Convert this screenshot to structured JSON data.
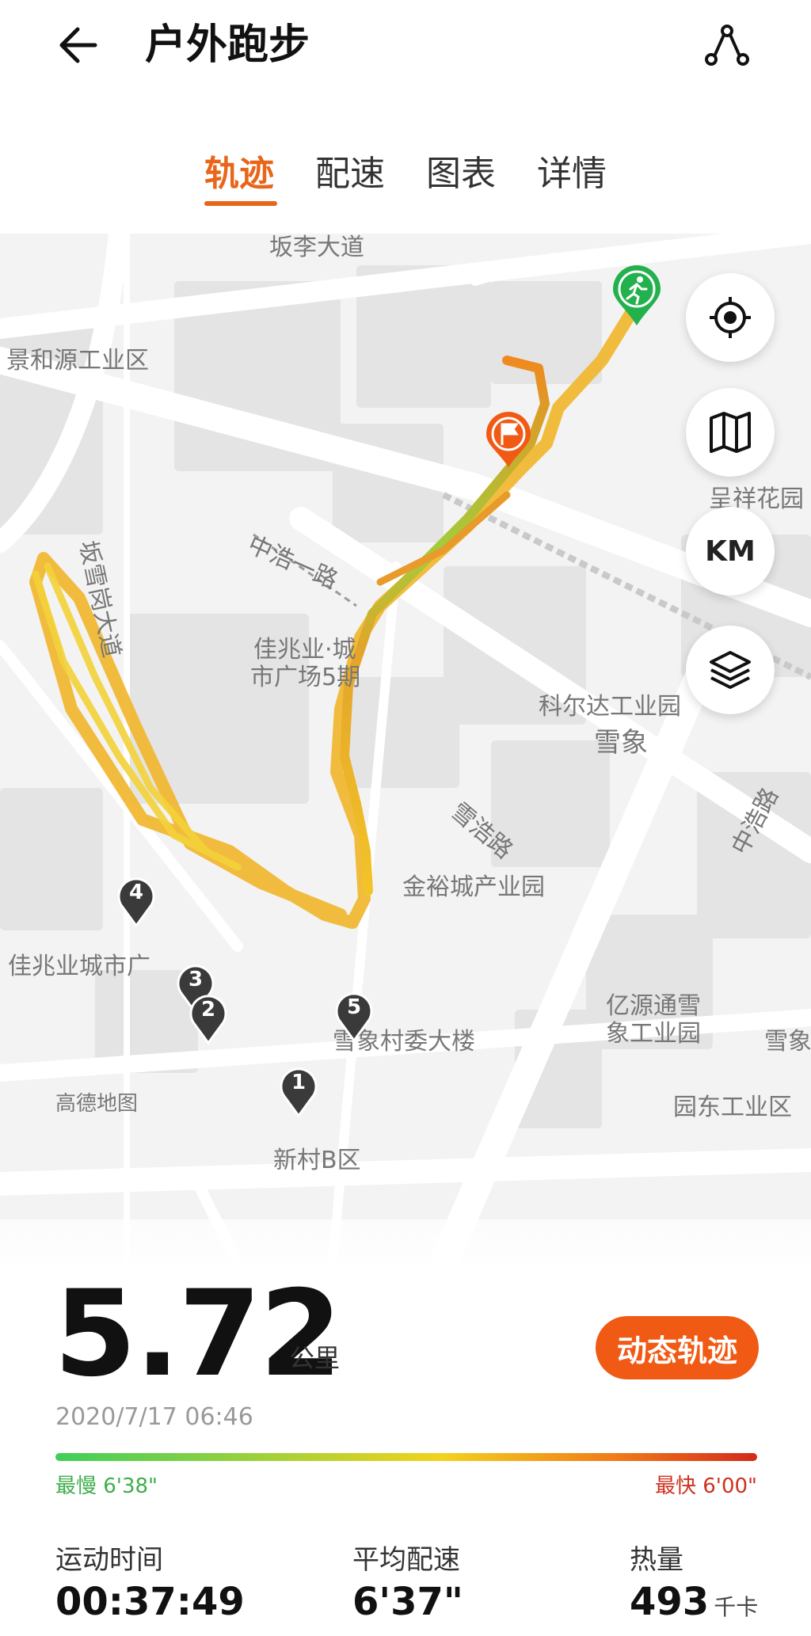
{
  "header": {
    "title": "户外跑步",
    "back_icon": "back-arrow-icon",
    "share_icon": "share-route-icon"
  },
  "tabs": [
    {
      "label": "轨迹",
      "active": true
    },
    {
      "label": "配速",
      "active": false
    },
    {
      "label": "图表",
      "active": false
    },
    {
      "label": "详情",
      "active": false
    }
  ],
  "map": {
    "labels": {
      "road_top": "坂李大道",
      "jinghe": "景和源工业区",
      "chengxiang": "呈祥花园",
      "zhonghao1": "中浩一路",
      "banxuegang": "坂雪岗大道",
      "jiazhao_a": "佳兆业·城",
      "jiazhao_b": "市广场5期",
      "keerda": "科尔达工业园",
      "xuexiang": "雪象",
      "xuehao": "雪浩路",
      "zhonghao": "中浩路",
      "jinyu": "金裕城产业园",
      "jiazhao_city": "佳兆业城市广",
      "yiyuan_a": "亿源通雪",
      "yiyuan_b": "象工业园",
      "xuexiang_right": "雪象",
      "xuexiang_cun": "雪象村委大楼",
      "gaode": "高德地图",
      "yuandong": "园东工业区",
      "xincun": "新村B区"
    },
    "km_markers": [
      "1",
      "2",
      "3",
      "4",
      "5"
    ],
    "controls": {
      "locate_icon": "locate-icon",
      "map_icon": "map-icon",
      "km_label": "KM",
      "layers_icon": "layers-icon"
    },
    "start_icon": "runner-start-icon",
    "end_icon": "finish-flag-icon"
  },
  "summary": {
    "distance": "5.72",
    "distance_unit": "公里",
    "dynamic_button": "动态轨迹",
    "date": "2020/7/17 06:46",
    "slowest": "最慢 6'38\"",
    "fastest": "最快 6'00\"",
    "colors": {
      "slow": "#3fcf5a",
      "mid": "#f3d21c",
      "fast": "#d32a1a",
      "accent": "#e8651a"
    }
  },
  "stats": [
    {
      "label": "运动时间",
      "value": "00:37:49",
      "unit": ""
    },
    {
      "label": "平均配速",
      "value": "6'37\"",
      "unit": ""
    },
    {
      "label": "热量",
      "value": "493",
      "unit": "千卡"
    }
  ]
}
